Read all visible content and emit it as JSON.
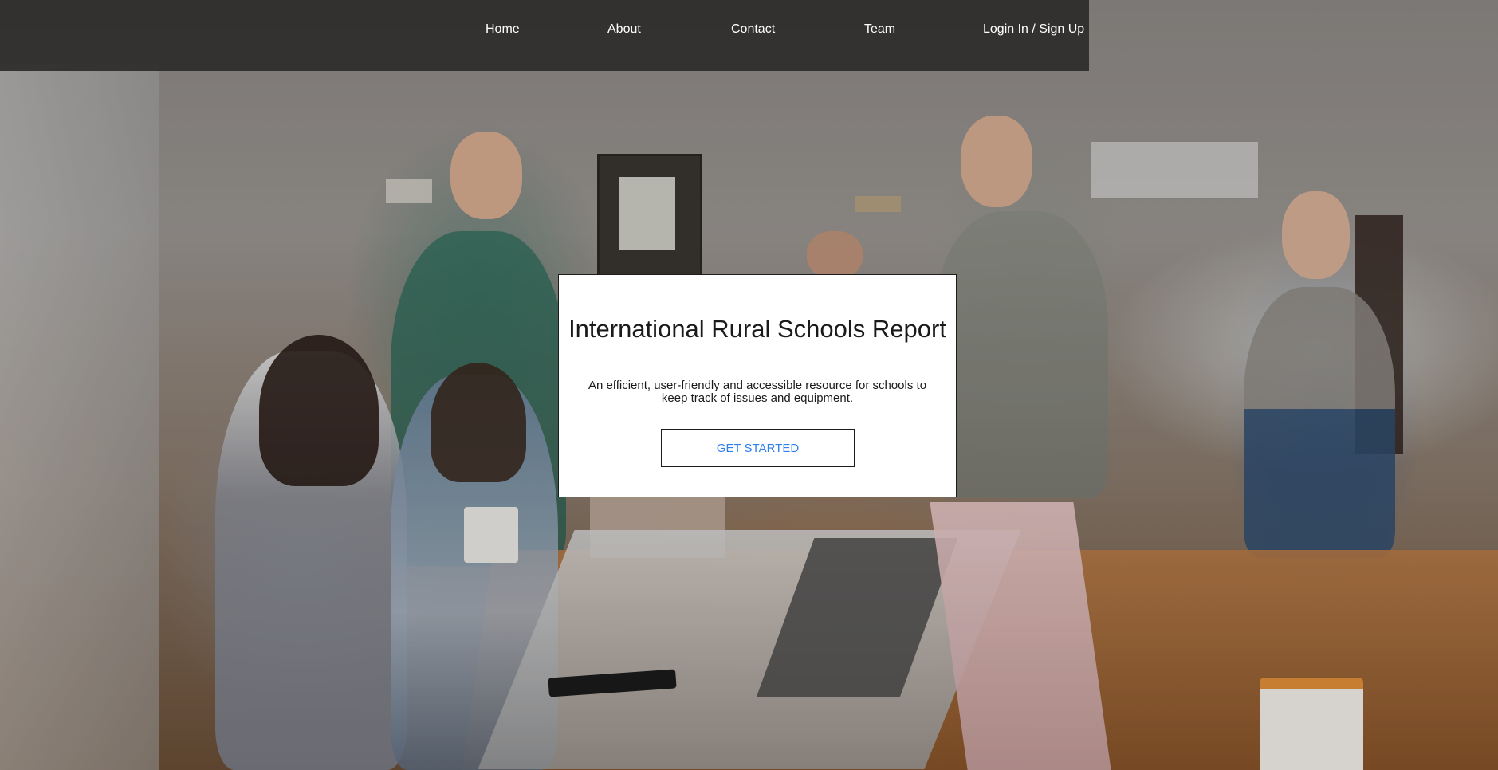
{
  "nav": {
    "items": [
      {
        "label": "Home"
      },
      {
        "label": "About"
      },
      {
        "label": "Contact"
      },
      {
        "label": "Team"
      },
      {
        "label": "Login In / Sign Up"
      }
    ]
  },
  "hero": {
    "title": "International Rural Schools Report",
    "description": "An efficient, user-friendly and accessible resource for schools to keep track of issues and equipment.",
    "cta_label": "GET STARTED"
  },
  "colors": {
    "navbar_bg": "#2d2b2a",
    "cta_text": "#2f80ed",
    "card_bg": "#ffffff"
  },
  "background": {
    "description_icon": "team-meeting-photo"
  }
}
